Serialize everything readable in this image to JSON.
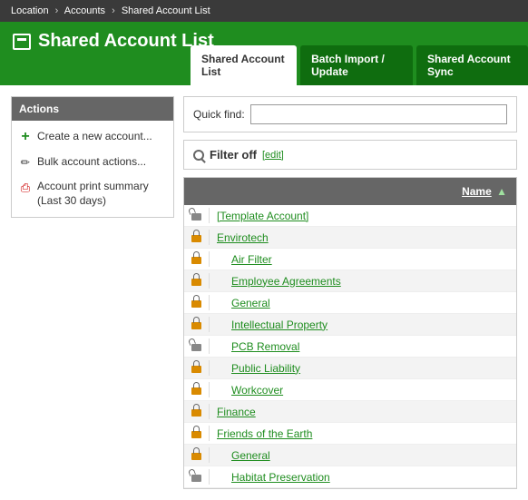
{
  "breadcrumb": {
    "root": "Location",
    "mid": "Accounts",
    "leaf": "Shared Account List"
  },
  "header": {
    "title": "Shared Account List"
  },
  "tabs": [
    {
      "label": "Shared Account List",
      "active": true
    },
    {
      "label": "Batch Import / Update",
      "active": false
    },
    {
      "label": "Shared Account Sync",
      "active": false
    }
  ],
  "actions": {
    "title": "Actions",
    "items": [
      {
        "icon": "plus",
        "label": "Create a new account..."
      },
      {
        "icon": "wand",
        "label": "Bulk account actions..."
      },
      {
        "icon": "pdf",
        "label": "Account print summary (Last 30 days)"
      }
    ]
  },
  "search": {
    "label": "Quick find:",
    "value": ""
  },
  "filter": {
    "status": "Filter off",
    "edit_label": "[edit]"
  },
  "table": {
    "header": {
      "name": "Name"
    },
    "rows": [
      {
        "label": "[Template Account]",
        "indent": 0,
        "lock": "open"
      },
      {
        "label": "Envirotech",
        "indent": 0,
        "lock": "locked"
      },
      {
        "label": "Air Filter",
        "indent": 1,
        "lock": "locked"
      },
      {
        "label": "Employee Agreements",
        "indent": 1,
        "lock": "locked"
      },
      {
        "label": "General",
        "indent": 1,
        "lock": "locked"
      },
      {
        "label": "Intellectual Property",
        "indent": 1,
        "lock": "locked"
      },
      {
        "label": "PCB Removal",
        "indent": 1,
        "lock": "open"
      },
      {
        "label": "Public Liability",
        "indent": 1,
        "lock": "locked"
      },
      {
        "label": "Workcover",
        "indent": 1,
        "lock": "locked"
      },
      {
        "label": "Finance",
        "indent": 0,
        "lock": "locked"
      },
      {
        "label": "Friends of the Earth",
        "indent": 0,
        "lock": "locked"
      },
      {
        "label": "General",
        "indent": 1,
        "lock": "locked"
      },
      {
        "label": "Habitat Preservation",
        "indent": 1,
        "lock": "open"
      }
    ]
  }
}
